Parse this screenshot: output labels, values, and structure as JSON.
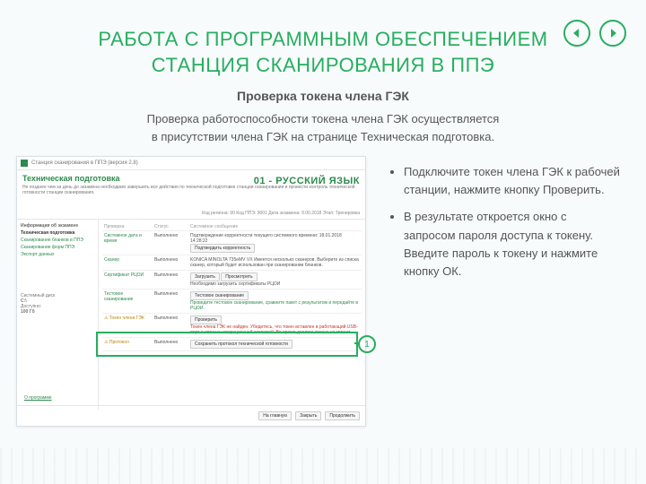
{
  "nav": {
    "prev": "◀",
    "next": "▶"
  },
  "title_line1": "РАБОТА С ПРОГРАММНЫМ ОБЕСПЕЧЕНИЕМ",
  "title_line2": "СТАНЦИЯ СКАНИРОВАНИЯ В ППЭ",
  "subtitle": "Проверка токена члена ГЭК",
  "intro_line1": "Проверка работоспособности токена члена ГЭК осуществляется",
  "intro_line2": "в присутствии члена ГЭК на странице Техническая подготовка.",
  "bullets": [
    "Подключите токен члена ГЭК к рабочей станции, нажмите кнопку Проверить.",
    "В результате откроется окно с запросом пароля доступа к токену. Введите пароль к токену и нажмите кнопку ОК."
  ],
  "callout_number": "1",
  "screenshot": {
    "window_title": "Станция сканирования в ППЭ (версия 2.8)",
    "page_title": "Техническая подготовка",
    "page_desc": "Не позднее чем за день до экзамена необходимо завершить все действия по технической подготовке станции сканирования и провести контроль технической готовности станции сканирования.",
    "subject": "01 - РУССКИЙ ЯЗЫК",
    "meta": "Код региона: 90   Код ППЭ: 9001   Дата экзамена: 9.00.2018   Этап: Тренировка",
    "sidebar": {
      "section1": "Информация об экзамене",
      "section1_items": [
        "Техническая подготовка",
        "Сканирование бланков в ППЭ",
        "Сканирование форм ППЭ",
        "Экспорт данных"
      ],
      "section2_label": "Системный диск",
      "section2_value1": "C:\\",
      "section2_value2": "Доступно:",
      "section2_value3": "100 Гб"
    },
    "table": {
      "headers": [
        "Проверка",
        "Статус",
        "Системное сообщение"
      ],
      "rows": [
        {
          "c1": "Системное дата и время",
          "c2": "Выполнено",
          "c3": "Подтверждение корректности текущего системного времени: 18.01.2018 14:28:22",
          "btn": "Подтвердить корректность"
        },
        {
          "c1": "Сканер",
          "c2": "Выполнено",
          "c3": "KONICA MINOLTA 735eMV VX\nИмеется несколько сканеров. Выберите из списка сканер, который будет использован при сканировании бланков."
        },
        {
          "c1": "Сертификат РЦОИ",
          "c2": "Выполнено",
          "c3": "",
          "btn1": "Загрузить",
          "btn2": "Просмотреть",
          "c3b": "Необходимо загрузить сертификаты РЦОИ"
        },
        {
          "c1": "Тестовое сканирование",
          "c2": "Выполнено",
          "c3": "",
          "btn": "Тестовое сканирование",
          "c3b": "Проведите тестовое сканирование, сравните пакет с результатом и передайте в РЦОИ."
        },
        {
          "c1": "Токен члена ГЭК",
          "c2": "Выполнено",
          "c3": "",
          "btn": "Проверить",
          "c3b": "Токен члена ГЭК не найден. Убедитесь, что токен вставлен в работающий USB-порт и опознан операционной системой. Во время диалога токена не мигает."
        },
        {
          "c1": "Протокол",
          "c2": "Выполнено",
          "c3": "",
          "btn": "Сохранить протокол технической готовности"
        }
      ]
    },
    "about": "О программе",
    "footer": [
      "На главную",
      "Закрыть",
      "Продолжить"
    ]
  }
}
